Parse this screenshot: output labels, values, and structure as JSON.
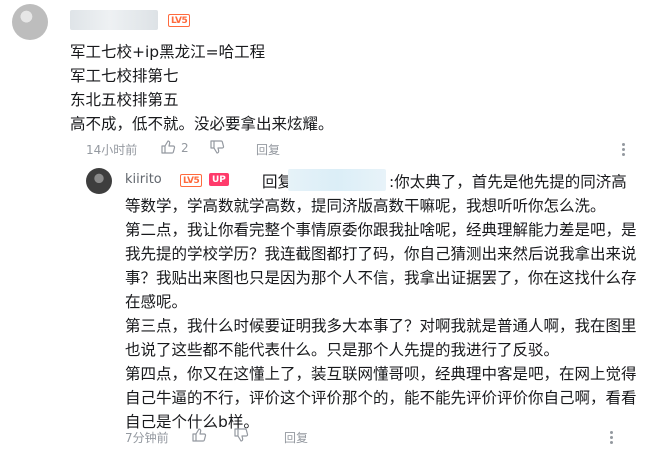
{
  "comment": {
    "level_badge": "LV5",
    "lines": [
      "军工七校+ip黑龙江=哈工程",
      "军工七校排第七",
      "东北五校排第五",
      "高不成，低不就。没必要拿出来炫耀。"
    ],
    "time": "14小时前",
    "likes": "2",
    "reply_label": "回复"
  },
  "reply": {
    "username": "kiirito",
    "level_badge": "LV5",
    "up_badge": "UP",
    "reply_prefix": "回复",
    "first_line_rest": ":你太典了，首先是他先提的同济高",
    "lines": [
      "等数学，学高数就学高数，提同济版高数干嘛呢，我想听听你怎么洗。",
      "第二点，我让你看完整个事情原委你跟我扯啥呢，经典理解能力差是吧，是",
      "我先提的学校学历？我连截图都打了码，你自己猜测出来然后说我拿出来说",
      "事？我贴出来图也只是因为那个人不信，我拿出证据罢了，你在这找什么存",
      "在感呢。",
      "第三点，我什么时候要证明我多大本事了？对啊我就是普通人啊，我在图里",
      "也说了这些都不能代表什么。只是那个人先提的我进行了反驳。",
      "第四点，你又在这懂上了，装互联网懂哥呗，经典理中客是吧，在网上觉得",
      "自己牛逼的不行，评价这个评价那个的，能不能先评价评价你自己啊，看看",
      "自己是个什么b样。"
    ],
    "time": "7分钟前",
    "reply_label": "回复"
  }
}
